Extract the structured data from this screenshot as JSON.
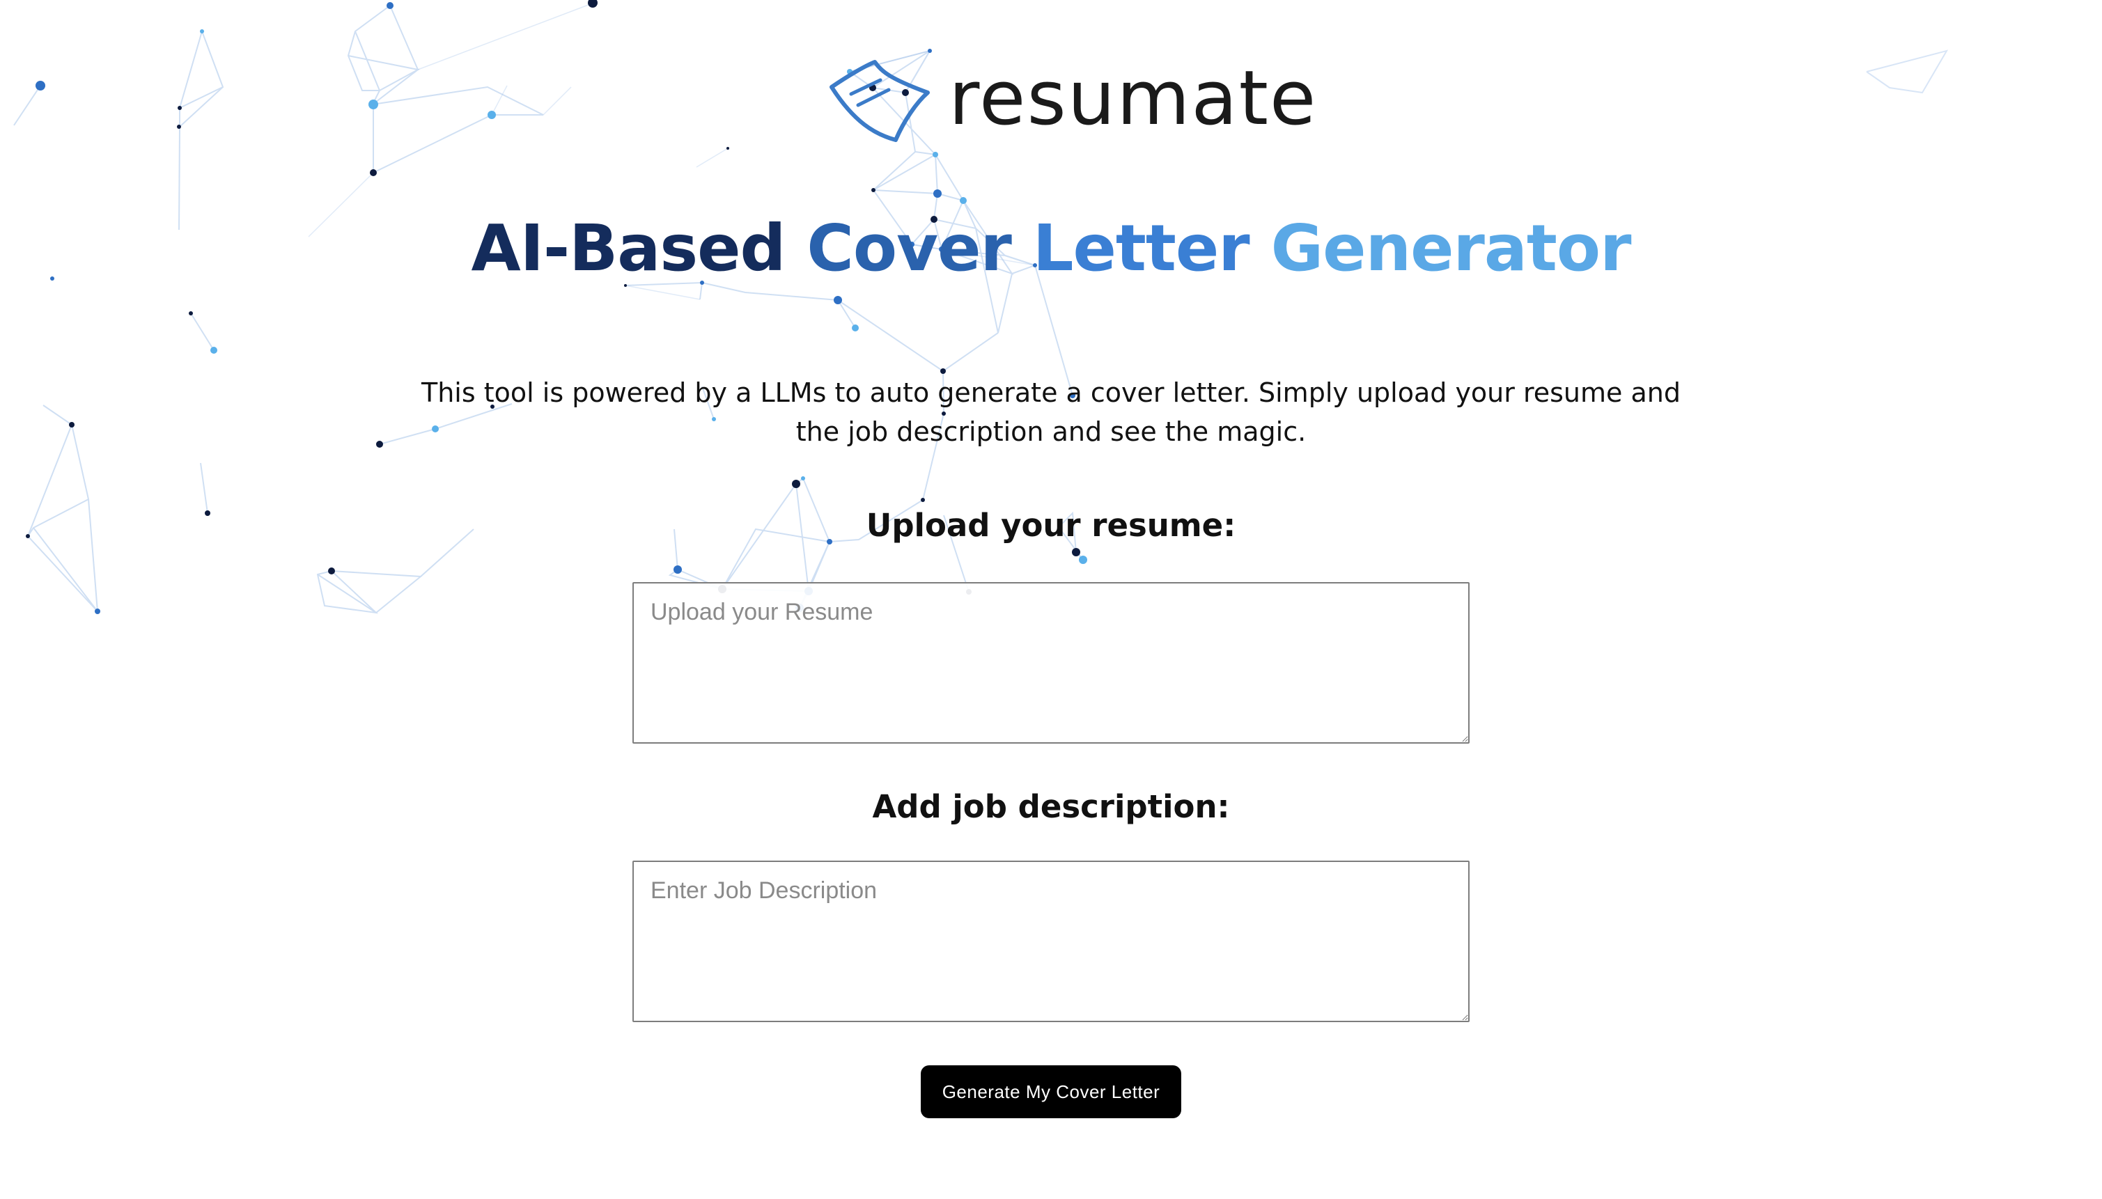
{
  "logo": {
    "icon": "paper-note-icon",
    "text": "resumate",
    "accent_color": "#3b7bc8"
  },
  "headline": {
    "word1": "AI-Based",
    "word2": "Cover",
    "word3": "Letter",
    "word4": "Generator",
    "gradient_colors": [
      "#142c5c",
      "#2a62ad",
      "#3a7fd4",
      "#5aa8e6"
    ]
  },
  "description": "This tool is powered by a LLMs to auto generate a cover letter. Simply upload your resume and the job description and see the magic.",
  "resume_section": {
    "label": "Upload your resume:",
    "placeholder": "Upload your Resume",
    "value": ""
  },
  "job_section": {
    "label": "Add job description:",
    "placeholder": "Enter Job Description",
    "value": ""
  },
  "generate_button": {
    "label": "Generate My Cover Letter",
    "background": "#000000",
    "text_color": "#ffffff"
  },
  "background": {
    "style": "network-nodes",
    "node_colors": [
      "#0d1b3e",
      "#2e6fc4",
      "#5ab0ea"
    ],
    "line_color": "#a9c6ea"
  }
}
